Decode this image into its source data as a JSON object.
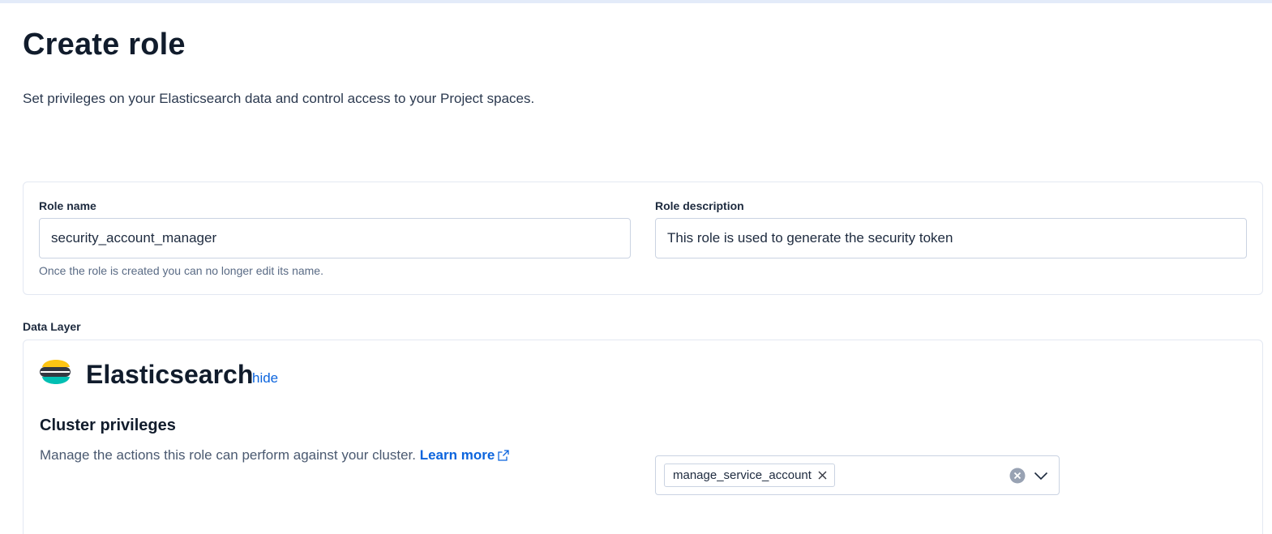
{
  "page": {
    "title": "Create role",
    "subtitle": "Set privileges on your Elasticsearch data and control access to your Project spaces."
  },
  "role_name": {
    "label": "Role name",
    "value": "security_account_manager",
    "help": "Once the role is created you can no longer edit its name."
  },
  "role_description": {
    "label": "Role description",
    "value": "This role is used to generate the security token"
  },
  "data_layer": {
    "label": "Data Layer"
  },
  "elasticsearch": {
    "title": "Elasticsearch",
    "hide_label": "hide",
    "logo_icon": "elasticsearch-logo",
    "cluster_privileges": {
      "title": "Cluster privileges",
      "description": "Manage the actions this role can perform against your cluster.",
      "learn_more": "Learn more",
      "selected": [
        "manage_service_account"
      ]
    }
  },
  "colors": {
    "link": "#0b64dd",
    "title": "#111c2c",
    "logo_yellow": "#fec514",
    "logo_navy": "#343741",
    "logo_teal": "#00bfb3"
  }
}
